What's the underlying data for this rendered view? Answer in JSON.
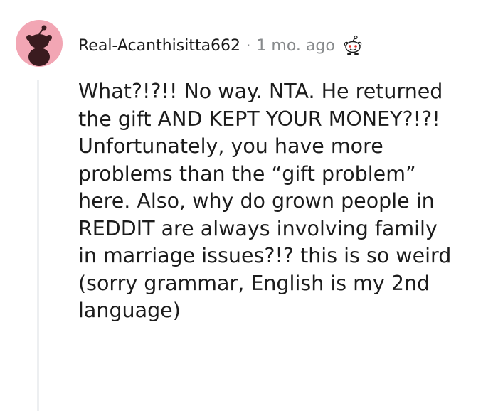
{
  "comment": {
    "author": "Real-Acanthisitta662",
    "separator": "·",
    "timestamp": "1 mo. ago",
    "award_icon": "snoo-award-icon",
    "avatar_icon": "snoo-avatar-icon",
    "body": "What?!?!! No way. NTA. He returned\nthe gift AND KEPT YOUR MONEY?!?!\nUnfortunately, you have more\nproblems than the “gift problem”\nhere. Also, why do grown people in\nREDDIT are always involving family\nin marriage issues?!? this is so weird\n(sorry grammar, English is my 2nd\nlanguage)"
  },
  "colors": {
    "avatar_bg": "#f2a6b4",
    "avatar_figure": "#3a1b1f",
    "text": "#1c1c1c",
    "muted": "#878a8c",
    "thread_line": "#edeff1"
  }
}
